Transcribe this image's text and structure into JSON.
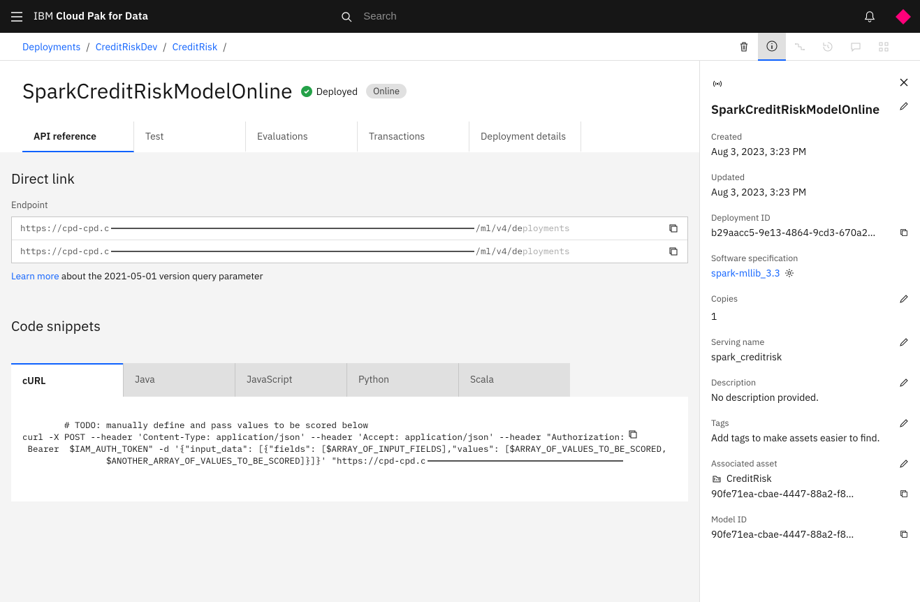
{
  "header": {
    "brand_light": "IBM",
    "brand_bold": "Cloud Pak for Data",
    "search_placeholder": "Search"
  },
  "breadcrumbs": [
    "Deployments",
    "CreditRiskDev",
    "CreditRisk"
  ],
  "page": {
    "title": "SparkCreditRiskModelOnline",
    "status_label": "Deployed",
    "chip_label": "Online",
    "tabs": [
      "API reference",
      "Test",
      "Evaluations",
      "Transactions",
      "Deployment details"
    ],
    "active_tab": 0
  },
  "direct_link": {
    "heading": "Direct link",
    "endpoint_label": "Endpoint",
    "endpoint_prefix": "https://cpd-cpd.c",
    "endpoint_suffix": "/ml/v4/de",
    "learn_link": "Learn more",
    "learn_text": " about the 2021-05-01 version query parameter"
  },
  "snippets": {
    "heading": "Code snippets",
    "tabs": [
      "cURL",
      "Java",
      "JavaScript",
      "Python",
      "Scala"
    ],
    "active": 0,
    "code": "# TODO: manually define and pass values to be scored below\ncurl -X POST --header 'Content-Type: application/json' --header 'Accept: application/json' --header \"Authorization:\n Bearer  $IAM_AUTH_TOKEN\" -d '{\"input_data\": [{\"fields\": [$ARRAY_OF_INPUT_FIELDS],\"values\": [$ARRAY_OF_VALUES_TO_BE_SCORED,\n                $ANOTHER_ARRAY_OF_VALUES_TO_BE_SCORED]}]}' \"https://cpd-cpd"
  },
  "side": {
    "title": "SparkCreditRiskModelOnline",
    "created_label": "Created",
    "created_val": "Aug 3, 2023, 3:23 PM",
    "updated_label": "Updated",
    "updated_val": "Aug 3, 2023, 3:23 PM",
    "depid_label": "Deployment ID",
    "depid_val": "b29aacc5-9e13-4864-9cd3-670a2…",
    "spec_label": "Software specification",
    "spec_val": "spark-mllib_3.3",
    "copies_label": "Copies",
    "copies_val": "1",
    "serving_label": "Serving name",
    "serving_val": "spark_creditrisk",
    "desc_label": "Description",
    "desc_val": "No description provided.",
    "tags_label": "Tags",
    "tags_val": "Add tags to make assets easier to find.",
    "asset_label": "Associated asset",
    "asset_name": "CreditRisk",
    "asset_id": "90fe71ea-cbae-4447-88a2-f8…",
    "model_label": "Model ID",
    "model_id": "90fe71ea-cbae-4447-88a2-f8…"
  }
}
